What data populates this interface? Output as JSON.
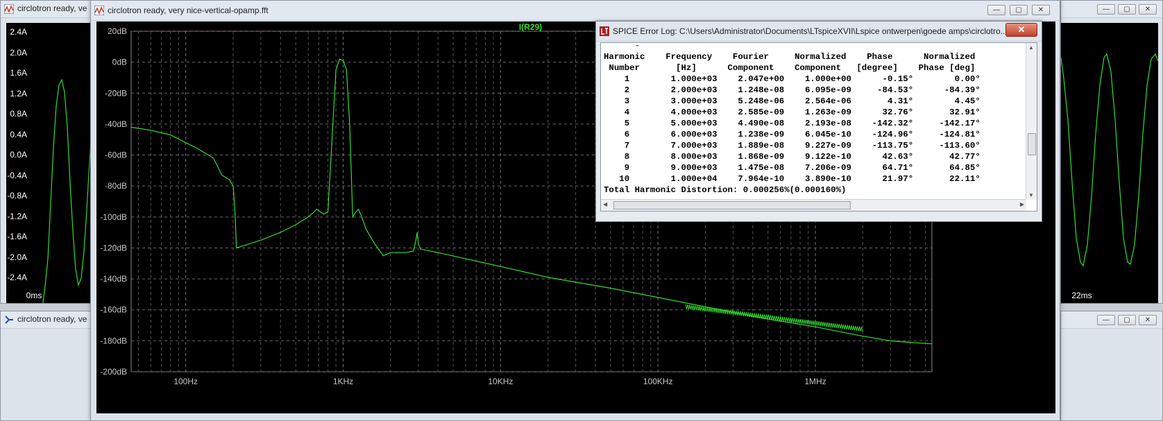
{
  "windows": {
    "left_title": "circlotron ready, ve",
    "bottom_left_title": "circlotron ready, ve",
    "main_title": "circlotron ready, very nice-vertical-opamp.fft",
    "error_log_title": "SPICE Error Log: C:\\Users\\Administrator\\Documents\\LTspiceXVII\\Lspice ontwerpen\\goede amps\\circlotro..."
  },
  "controls": {
    "minimize": "—",
    "maximize": "▢",
    "close": "✕"
  },
  "left_plot": {
    "y_ticks": [
      "2.4A",
      "2.0A",
      "1.6A",
      "1.2A",
      "0.8A",
      "0.4A",
      "0.0A",
      "-0.4A",
      "-0.8A",
      "-1.2A",
      "-1.6A",
      "-2.0A",
      "-2.4A"
    ],
    "x_tick": "0ms"
  },
  "right_plot": {
    "x_tick": "22ms"
  },
  "chart_data": {
    "type": "line",
    "title": "I(R29)",
    "xlabel": "",
    "ylabel": "",
    "x_scale": "log",
    "xlim": [
      45,
      5500000
    ],
    "ylim": [
      -200,
      20
    ],
    "y_ticks": [
      "20dB",
      "0dB",
      "-20dB",
      "-40dB",
      "-60dB",
      "-80dB",
      "-100dB",
      "-120dB",
      "-140dB",
      "-160dB",
      "-180dB",
      "-200dB"
    ],
    "x_ticks": [
      {
        "value": 100,
        "label": "100Hz"
      },
      {
        "value": 1000,
        "label": "1KHz"
      },
      {
        "value": 10000,
        "label": "10KHz"
      },
      {
        "value": 100000,
        "label": "100KHz"
      },
      {
        "value": 1000000,
        "label": "1MHz"
      }
    ],
    "grid": true,
    "color": "#33dd33",
    "series": [
      {
        "name": "I(R29)",
        "x": [
          45,
          60,
          80,
          100,
          120,
          150,
          170,
          190,
          200,
          205,
          210,
          300,
          400,
          500,
          600,
          650,
          680,
          700,
          750,
          800,
          850,
          900,
          950,
          1000,
          1050,
          1100,
          1150,
          1200,
          1250,
          1300,
          1400,
          1600,
          1800,
          1900,
          2000,
          2200,
          2500,
          2800,
          2900,
          2950,
          3000,
          3100,
          3200,
          4000,
          6000,
          10000,
          20000,
          50000,
          100000,
          200000,
          500000,
          1000000,
          2000000,
          3000000,
          4000000,
          5500000
        ],
        "y": [
          -42,
          -44,
          -47,
          -52,
          -56,
          -62,
          -73,
          -76,
          -80,
          -95,
          -120,
          -115,
          -110,
          -105,
          -100,
          -97,
          -95,
          -96,
          -98,
          -97,
          -50,
          -5,
          2,
          1,
          -5,
          -40,
          -100,
          -97,
          -95,
          -99,
          -108,
          -118,
          -125,
          -124,
          -123,
          -123,
          -123,
          -122,
          -115,
          -110,
          -117,
          -121,
          -121,
          -123,
          -127,
          -132,
          -139,
          -146,
          -152,
          -158,
          -166,
          -171,
          -177,
          -180,
          -181,
          -182
        ]
      }
    ]
  },
  "error_log": {
    "header1": "Harmonic    Frequency    Fourier     Normalized    Phase      Normalized",
    "header2": " Number       [Hz]      Component    Component   [degree]    Phase [deg]",
    "rows": [
      "    1        1.000e+03    2.047e+00    1.000e+00      -0.15°        0.00°",
      "    2        2.000e+03    1.248e-08    6.095e-09     -84.53°      -84.39°",
      "    3        3.000e+03    5.248e-06    2.564e-06       4.31°        4.45°",
      "    4        4.000e+03    2.585e-09    1.263e-09      32.76°       32.91°",
      "    5        5.000e+03    4.490e-08    2.193e-08    -142.32°     -142.17°",
      "    6        6.000e+03    1.238e-09    6.045e-10    -124.96°     -124.81°",
      "    7        7.000e+03    1.889e-08    9.227e-09    -113.75°     -113.60°",
      "    8        8.000e+03    1.868e-09    9.122e-10      42.63°       42.77°",
      "    9        9.000e+03    1.475e-08    7.206e-09      64.71°       64.85°",
      "   10        1.000e+04    7.964e-10    3.890e-10      21.97°       22.11°"
    ],
    "thd": "Total Harmonic Distortion: 0.000256%(0.000160%)"
  }
}
